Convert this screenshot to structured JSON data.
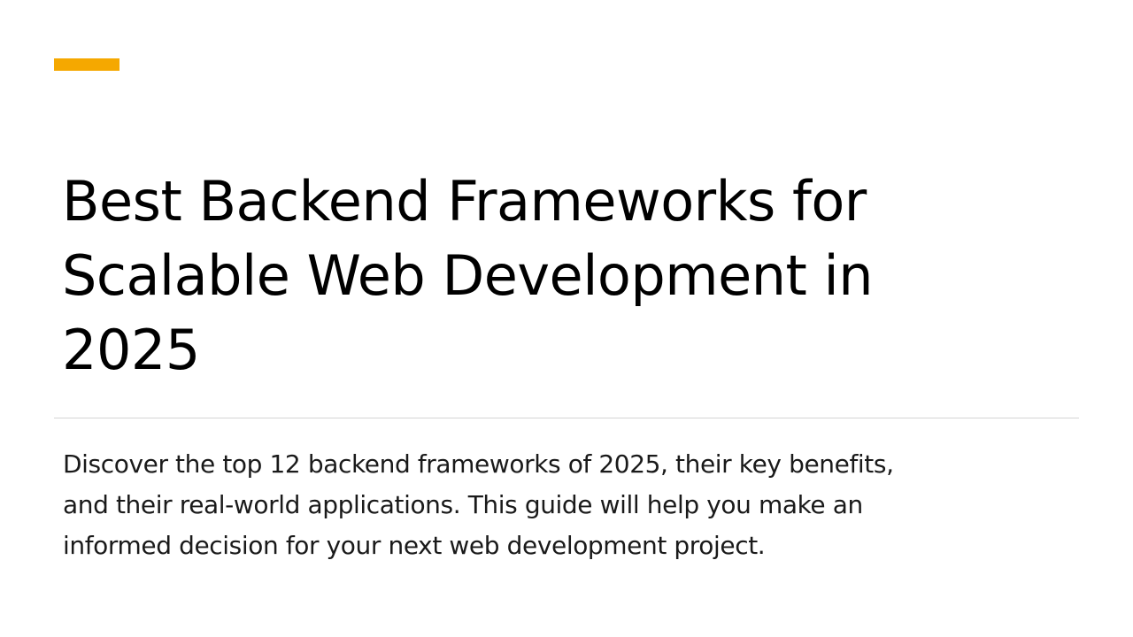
{
  "slide": {
    "accent_color": "#F5A800",
    "title": "Best Backend Frameworks for\nScalable Web Development in\n2025",
    "subtitle": "Discover the top 12 backend frameworks of 2025, their key benefits,\nand their real-world applications. This guide will help you make an\ninformed decision for your next web development project."
  }
}
